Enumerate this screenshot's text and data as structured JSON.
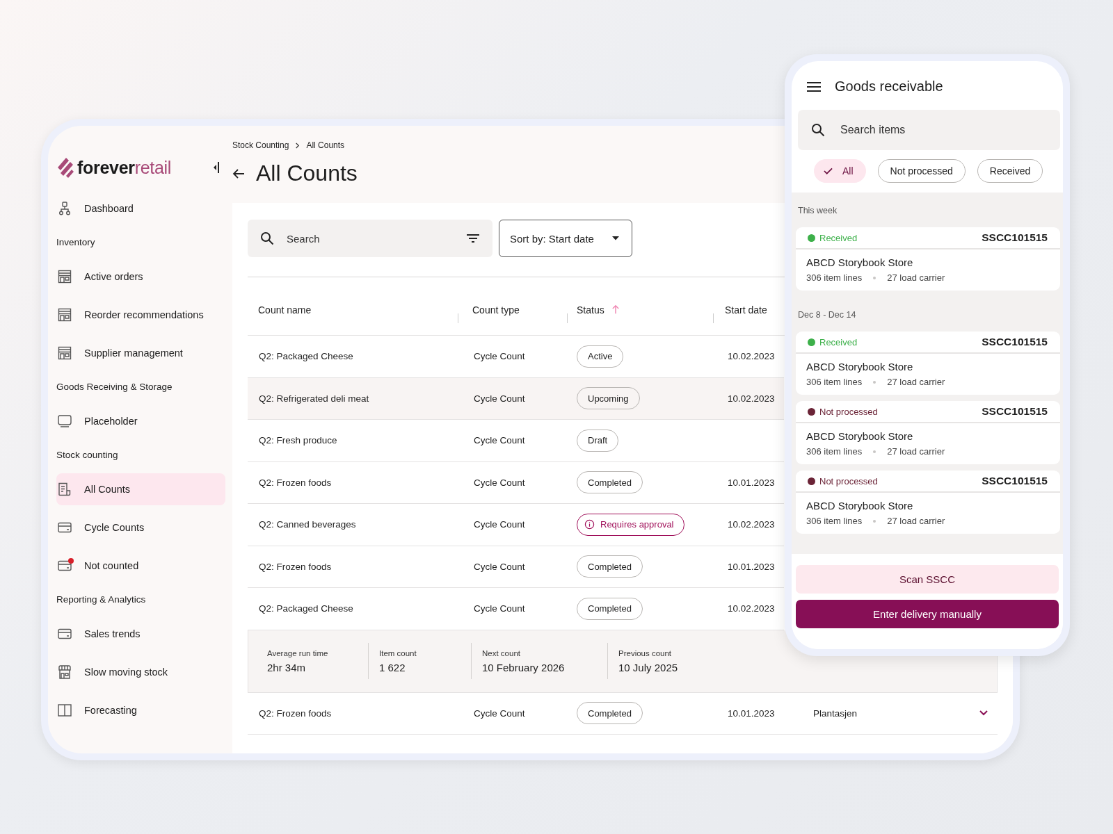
{
  "logo": {
    "dark": "forever",
    "accent": "retail"
  },
  "sidebar": {
    "items": [
      {
        "kind": "item",
        "label": "Dashboard",
        "selected": false,
        "alert": false
      },
      {
        "kind": "section",
        "label": "Inventory"
      },
      {
        "kind": "item",
        "label": "Active orders",
        "selected": false,
        "alert": false
      },
      {
        "kind": "item",
        "label": "Reorder recommendations",
        "selected": false,
        "alert": false
      },
      {
        "kind": "item",
        "label": "Supplier management",
        "selected": false,
        "alert": false
      },
      {
        "kind": "section",
        "label": "Goods Receiving & Storage"
      },
      {
        "kind": "item",
        "label": "Placeholder",
        "selected": false,
        "alert": false
      },
      {
        "kind": "section",
        "label": "Stock counting"
      },
      {
        "kind": "item",
        "label": "All Counts",
        "selected": true,
        "alert": false
      },
      {
        "kind": "item",
        "label": "Cycle Counts",
        "selected": false,
        "alert": false
      },
      {
        "kind": "item",
        "label": "Not counted",
        "selected": false,
        "alert": true
      },
      {
        "kind": "section",
        "label": "Reporting & Analytics"
      },
      {
        "kind": "item",
        "label": "Sales trends",
        "selected": false,
        "alert": false
      },
      {
        "kind": "item",
        "label": "Slow moving stock",
        "selected": false,
        "alert": false
      },
      {
        "kind": "item",
        "label": "Forecasting",
        "selected": false,
        "alert": false
      }
    ]
  },
  "breadcrumb": [
    "Stock Counting",
    "All Counts"
  ],
  "title": "All Counts",
  "toolbar": {
    "search_placeholder": "Search",
    "sort": "Sort by: Start date"
  },
  "table": {
    "columns": [
      {
        "label": "Count name",
        "sorted": false
      },
      {
        "label": "Count type",
        "sorted": false
      },
      {
        "label": "Status",
        "sorted": true
      },
      {
        "label": "Start date",
        "sorted": false
      }
    ],
    "rows": [
      {
        "name": "Q2: Packaged Cheese",
        "type": "Cycle Count",
        "status": {
          "label": "Active",
          "kind": "normal"
        },
        "start": "10.02.2023",
        "hovered": false
      },
      {
        "name": "Q2: Refrigerated deli meat",
        "type": "Cycle Count",
        "status": {
          "label": "Upcoming",
          "kind": "normal"
        },
        "start": "10.02.2023",
        "hovered": true
      },
      {
        "name": "Q2: Fresh produce",
        "type": "Cycle Count",
        "status": {
          "label": "Draft",
          "kind": "normal"
        },
        "hovered": false
      },
      {
        "name": "Q2: Frozen foods",
        "type": "Cycle Count",
        "status": {
          "label": "Completed",
          "kind": "normal"
        },
        "start": "10.01.2023",
        "hovered": false
      },
      {
        "name": "Q2: Canned beverages",
        "type": "Cycle Count",
        "status": {
          "label": "Requires approval",
          "kind": "warning"
        },
        "start": "10.02.2023",
        "hovered": false
      },
      {
        "name": "Q2: Frozen foods",
        "type": "Cycle Count",
        "status": {
          "label": "Completed",
          "kind": "normal"
        },
        "start": "10.01.2023",
        "hovered": false
      },
      {
        "name": "Q2: Packaged Cheese",
        "type": "Cycle Count",
        "status": {
          "label": "Completed",
          "kind": "normal"
        },
        "start": "10.02.2023",
        "hovered": false,
        "details": [
          {
            "label": "Average run time",
            "value": "2hr 34m"
          },
          {
            "label": "Item count",
            "value": "1 622"
          },
          {
            "label": "Next count",
            "value": "10 February 2026"
          },
          {
            "label": "Previous count",
            "value": "10 July 2025"
          }
        ]
      },
      {
        "name": "Q2: Frozen foods",
        "type": "Cycle Count",
        "status": {
          "label": "Completed",
          "kind": "normal"
        },
        "start": "10.01.2023",
        "store": "Plantasjen",
        "hovered": false
      }
    ]
  },
  "phone": {
    "title": "Goods receivable",
    "search_placeholder": "Search items",
    "chips": [
      {
        "label": "All",
        "selected": true
      },
      {
        "label": "Not processed",
        "selected": false
      },
      {
        "label": "Received",
        "selected": false
      }
    ],
    "groups": [
      {
        "heading": "This week",
        "cards": [
          {
            "status": {
              "label": "Received",
              "color": "#3db04a"
            },
            "code": "SSCC101515",
            "store": "ABCD Storybook Store",
            "lines": "306 item lines",
            "carriers": "27 load carrier"
          }
        ]
      },
      {
        "heading": "Dec 8 - Dec 14",
        "cards": [
          {
            "status": {
              "label": "Received",
              "color": "#3db04a"
            },
            "code": "SSCC101515",
            "store": "ABCD Storybook Store",
            "lines": "306 item lines",
            "carriers": "27 load carrier"
          },
          {
            "status": {
              "label": "Not processed",
              "color": "#6b2437"
            },
            "code": "SSCC101515",
            "store": "ABCD Storybook Store",
            "lines": "306 item lines",
            "carriers": "27 load carrier"
          },
          {
            "status": {
              "label": "Not processed",
              "color": "#6b2437"
            },
            "code": "SSCC101515",
            "store": "ABCD Storybook Store",
            "lines": "306 item lines",
            "carriers": "27 load carrier"
          }
        ]
      }
    ],
    "buttons": [
      {
        "label": "Scan SSCC",
        "kind": "secondary"
      },
      {
        "label": "Enter delivery manually",
        "kind": "primary"
      }
    ]
  }
}
